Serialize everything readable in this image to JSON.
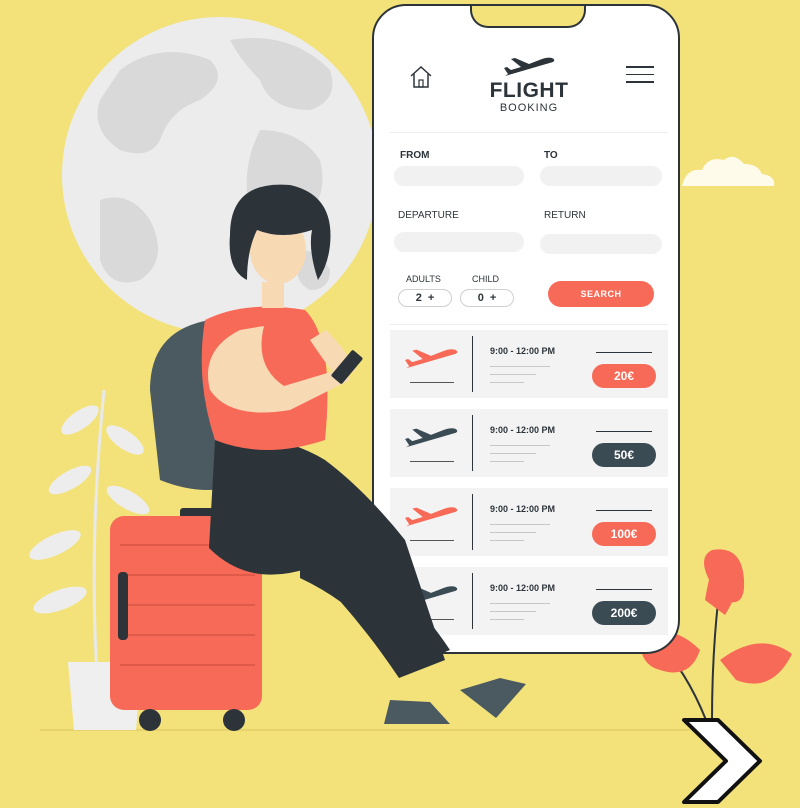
{
  "app": {
    "brand_title": "FLIGHT",
    "brand_subtitle": "BOOKING"
  },
  "icons": {
    "home": "home-icon",
    "menu": "hamburger-menu-icon",
    "plane": "airplane-icon",
    "next": "chevron-right-icon"
  },
  "form": {
    "from_label": "FROM",
    "to_label": "TO",
    "departure_label": "DEPARTURE",
    "return_label": "RETURN",
    "adults_label": "ADULTS",
    "child_label": "CHILD",
    "adults_value": "2",
    "child_value": "0",
    "stepper_plus": "+",
    "search_label": "SEARCH"
  },
  "results": [
    {
      "time": "9:00 - 12:00 PM",
      "price": "20€",
      "color": "#F86A58"
    },
    {
      "time": "9:00 - 12:00 PM",
      "price": "50€",
      "color": "#3B4B54"
    },
    {
      "time": "9:00 - 12:00 PM",
      "price": "100€",
      "color": "#F86A58"
    },
    {
      "time": "9:00 - 12:00 PM",
      "price": "200€",
      "color": "#3B4B54"
    }
  ],
  "colors": {
    "background": "#F3E27A",
    "accent": "#F86A58",
    "dark": "#3B4B54"
  }
}
